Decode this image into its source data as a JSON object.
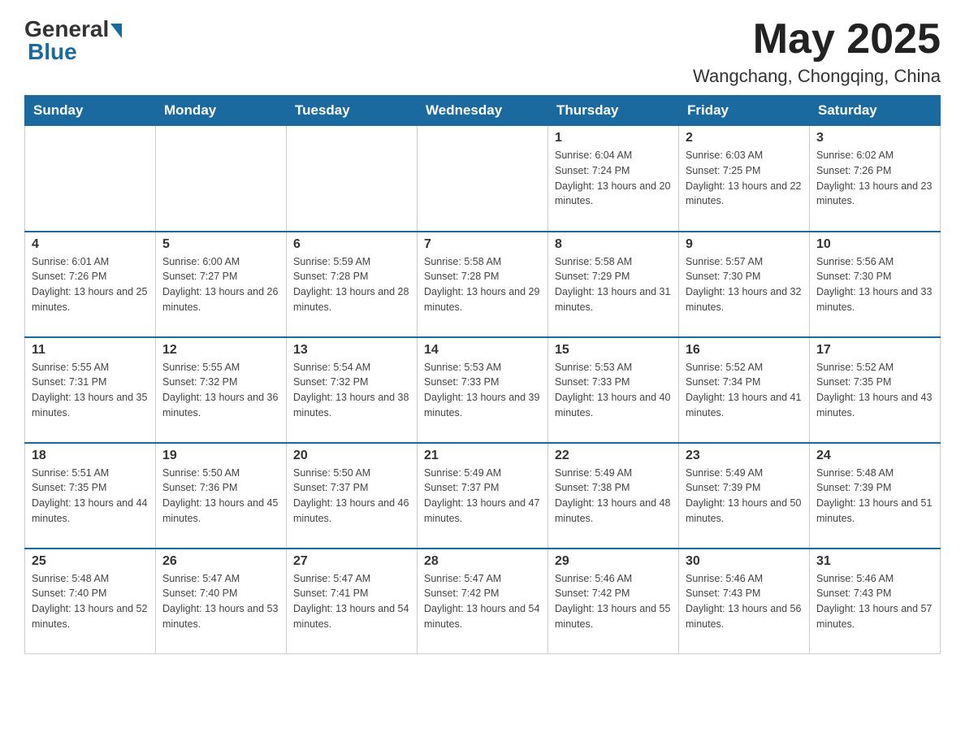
{
  "header": {
    "logo_general": "General",
    "logo_blue": "Blue",
    "month_title": "May 2025",
    "location": "Wangchang, Chongqing, China"
  },
  "days_of_week": [
    "Sunday",
    "Monday",
    "Tuesday",
    "Wednesday",
    "Thursday",
    "Friday",
    "Saturday"
  ],
  "weeks": [
    [
      {
        "day": "",
        "sunrise": "",
        "sunset": "",
        "daylight": ""
      },
      {
        "day": "",
        "sunrise": "",
        "sunset": "",
        "daylight": ""
      },
      {
        "day": "",
        "sunrise": "",
        "sunset": "",
        "daylight": ""
      },
      {
        "day": "",
        "sunrise": "",
        "sunset": "",
        "daylight": ""
      },
      {
        "day": "1",
        "sunrise": "Sunrise: 6:04 AM",
        "sunset": "Sunset: 7:24 PM",
        "daylight": "Daylight: 13 hours and 20 minutes."
      },
      {
        "day": "2",
        "sunrise": "Sunrise: 6:03 AM",
        "sunset": "Sunset: 7:25 PM",
        "daylight": "Daylight: 13 hours and 22 minutes."
      },
      {
        "day": "3",
        "sunrise": "Sunrise: 6:02 AM",
        "sunset": "Sunset: 7:26 PM",
        "daylight": "Daylight: 13 hours and 23 minutes."
      }
    ],
    [
      {
        "day": "4",
        "sunrise": "Sunrise: 6:01 AM",
        "sunset": "Sunset: 7:26 PM",
        "daylight": "Daylight: 13 hours and 25 minutes."
      },
      {
        "day": "5",
        "sunrise": "Sunrise: 6:00 AM",
        "sunset": "Sunset: 7:27 PM",
        "daylight": "Daylight: 13 hours and 26 minutes."
      },
      {
        "day": "6",
        "sunrise": "Sunrise: 5:59 AM",
        "sunset": "Sunset: 7:28 PM",
        "daylight": "Daylight: 13 hours and 28 minutes."
      },
      {
        "day": "7",
        "sunrise": "Sunrise: 5:58 AM",
        "sunset": "Sunset: 7:28 PM",
        "daylight": "Daylight: 13 hours and 29 minutes."
      },
      {
        "day": "8",
        "sunrise": "Sunrise: 5:58 AM",
        "sunset": "Sunset: 7:29 PM",
        "daylight": "Daylight: 13 hours and 31 minutes."
      },
      {
        "day": "9",
        "sunrise": "Sunrise: 5:57 AM",
        "sunset": "Sunset: 7:30 PM",
        "daylight": "Daylight: 13 hours and 32 minutes."
      },
      {
        "day": "10",
        "sunrise": "Sunrise: 5:56 AM",
        "sunset": "Sunset: 7:30 PM",
        "daylight": "Daylight: 13 hours and 33 minutes."
      }
    ],
    [
      {
        "day": "11",
        "sunrise": "Sunrise: 5:55 AM",
        "sunset": "Sunset: 7:31 PM",
        "daylight": "Daylight: 13 hours and 35 minutes."
      },
      {
        "day": "12",
        "sunrise": "Sunrise: 5:55 AM",
        "sunset": "Sunset: 7:32 PM",
        "daylight": "Daylight: 13 hours and 36 minutes."
      },
      {
        "day": "13",
        "sunrise": "Sunrise: 5:54 AM",
        "sunset": "Sunset: 7:32 PM",
        "daylight": "Daylight: 13 hours and 38 minutes."
      },
      {
        "day": "14",
        "sunrise": "Sunrise: 5:53 AM",
        "sunset": "Sunset: 7:33 PM",
        "daylight": "Daylight: 13 hours and 39 minutes."
      },
      {
        "day": "15",
        "sunrise": "Sunrise: 5:53 AM",
        "sunset": "Sunset: 7:33 PM",
        "daylight": "Daylight: 13 hours and 40 minutes."
      },
      {
        "day": "16",
        "sunrise": "Sunrise: 5:52 AM",
        "sunset": "Sunset: 7:34 PM",
        "daylight": "Daylight: 13 hours and 41 minutes."
      },
      {
        "day": "17",
        "sunrise": "Sunrise: 5:52 AM",
        "sunset": "Sunset: 7:35 PM",
        "daylight": "Daylight: 13 hours and 43 minutes."
      }
    ],
    [
      {
        "day": "18",
        "sunrise": "Sunrise: 5:51 AM",
        "sunset": "Sunset: 7:35 PM",
        "daylight": "Daylight: 13 hours and 44 minutes."
      },
      {
        "day": "19",
        "sunrise": "Sunrise: 5:50 AM",
        "sunset": "Sunset: 7:36 PM",
        "daylight": "Daylight: 13 hours and 45 minutes."
      },
      {
        "day": "20",
        "sunrise": "Sunrise: 5:50 AM",
        "sunset": "Sunset: 7:37 PM",
        "daylight": "Daylight: 13 hours and 46 minutes."
      },
      {
        "day": "21",
        "sunrise": "Sunrise: 5:49 AM",
        "sunset": "Sunset: 7:37 PM",
        "daylight": "Daylight: 13 hours and 47 minutes."
      },
      {
        "day": "22",
        "sunrise": "Sunrise: 5:49 AM",
        "sunset": "Sunset: 7:38 PM",
        "daylight": "Daylight: 13 hours and 48 minutes."
      },
      {
        "day": "23",
        "sunrise": "Sunrise: 5:49 AM",
        "sunset": "Sunset: 7:39 PM",
        "daylight": "Daylight: 13 hours and 50 minutes."
      },
      {
        "day": "24",
        "sunrise": "Sunrise: 5:48 AM",
        "sunset": "Sunset: 7:39 PM",
        "daylight": "Daylight: 13 hours and 51 minutes."
      }
    ],
    [
      {
        "day": "25",
        "sunrise": "Sunrise: 5:48 AM",
        "sunset": "Sunset: 7:40 PM",
        "daylight": "Daylight: 13 hours and 52 minutes."
      },
      {
        "day": "26",
        "sunrise": "Sunrise: 5:47 AM",
        "sunset": "Sunset: 7:40 PM",
        "daylight": "Daylight: 13 hours and 53 minutes."
      },
      {
        "day": "27",
        "sunrise": "Sunrise: 5:47 AM",
        "sunset": "Sunset: 7:41 PM",
        "daylight": "Daylight: 13 hours and 54 minutes."
      },
      {
        "day": "28",
        "sunrise": "Sunrise: 5:47 AM",
        "sunset": "Sunset: 7:42 PM",
        "daylight": "Daylight: 13 hours and 54 minutes."
      },
      {
        "day": "29",
        "sunrise": "Sunrise: 5:46 AM",
        "sunset": "Sunset: 7:42 PM",
        "daylight": "Daylight: 13 hours and 55 minutes."
      },
      {
        "day": "30",
        "sunrise": "Sunrise: 5:46 AM",
        "sunset": "Sunset: 7:43 PM",
        "daylight": "Daylight: 13 hours and 56 minutes."
      },
      {
        "day": "31",
        "sunrise": "Sunrise: 5:46 AM",
        "sunset": "Sunset: 7:43 PM",
        "daylight": "Daylight: 13 hours and 57 minutes."
      }
    ]
  ]
}
